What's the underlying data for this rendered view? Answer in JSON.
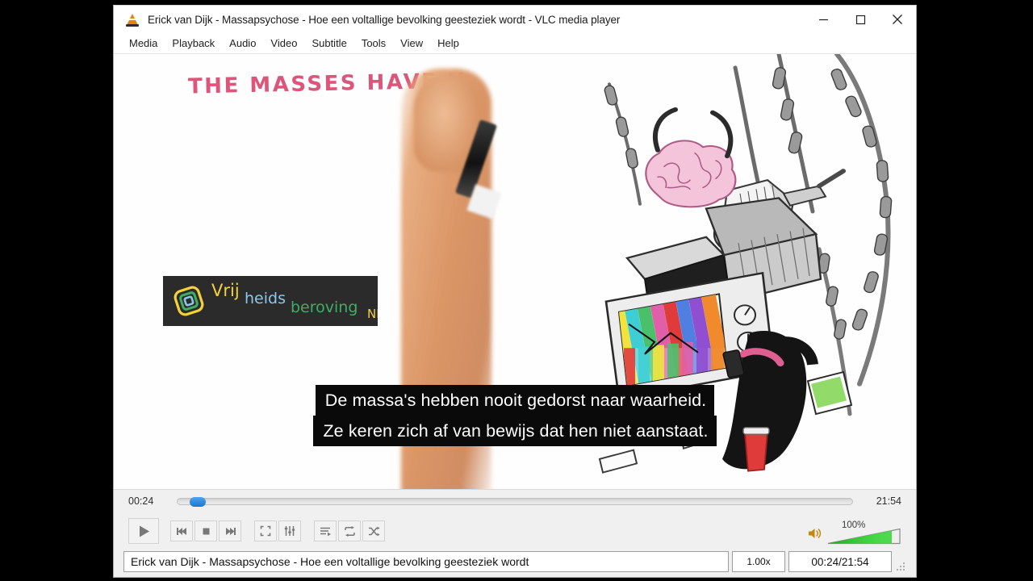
{
  "window": {
    "title": "Erick van Dijk - Massapsychose - Hoe een voltallige bevolking geesteziek wordt - VLC media player",
    "app_icon": "vlc-cone-icon",
    "minimize_label": "–",
    "maximize_label": "□",
    "close_label": "✕"
  },
  "menubar": {
    "items": [
      {
        "label": "Media"
      },
      {
        "label": "Playback"
      },
      {
        "label": "Audio"
      },
      {
        "label": "Video"
      },
      {
        "label": "Subtitle"
      },
      {
        "label": "Tools"
      },
      {
        "label": "View"
      },
      {
        "label": "Help"
      }
    ]
  },
  "video": {
    "headline_text": "THE MASSES HAVE N",
    "watermark": {
      "word1": "Vrij",
      "word2": "heids",
      "word3": "beroving",
      "word4": "NL",
      "color1": "#f2d23c",
      "color2": "#8fc7e8",
      "color3": "#3fae63",
      "color4": "#f2d23c",
      "background": "#2b2b2b"
    },
    "subtitles": [
      "De massa's hebben nooit gedorst naar waarheid.",
      "Ze keren zich af van bewijs dat hen niet aanstaat."
    ],
    "subtitle_background": "#0a0a0a",
    "subtitle_color": "#ffffff"
  },
  "controls": {
    "seek": {
      "elapsed": "00:24",
      "total": "21:54",
      "progress_percent": 1.8,
      "handle_color": "#1976d2"
    },
    "buttons": [
      {
        "name": "play-button",
        "icon": "play-icon",
        "label": "Play"
      },
      {
        "name": "previous-button",
        "icon": "previous-icon",
        "label": "Previous"
      },
      {
        "name": "stop-button",
        "icon": "stop-icon",
        "label": "Stop"
      },
      {
        "name": "next-button",
        "icon": "next-icon",
        "label": "Next"
      },
      {
        "name": "fullscreen-button",
        "icon": "fullscreen-icon",
        "label": "Toggle fullscreen"
      },
      {
        "name": "settings-button",
        "icon": "equalizer-icon",
        "label": "Show extended settings"
      },
      {
        "name": "playlist-button",
        "icon": "playlist-icon",
        "label": "Show playlist"
      },
      {
        "name": "loop-button",
        "icon": "loop-icon",
        "label": "Loop"
      },
      {
        "name": "shuffle-button",
        "icon": "shuffle-icon",
        "label": "Random"
      }
    ],
    "volume": {
      "icon": "speaker-icon",
      "percent_label": "100%",
      "value": 100,
      "color": "#33cc33"
    }
  },
  "statusbar": {
    "title": "Erick van Dijk - Massapsychose - Hoe een voltallige bevolking geesteziek wordt",
    "playback_rate": "1.00x",
    "time": "00:24/21:54"
  }
}
